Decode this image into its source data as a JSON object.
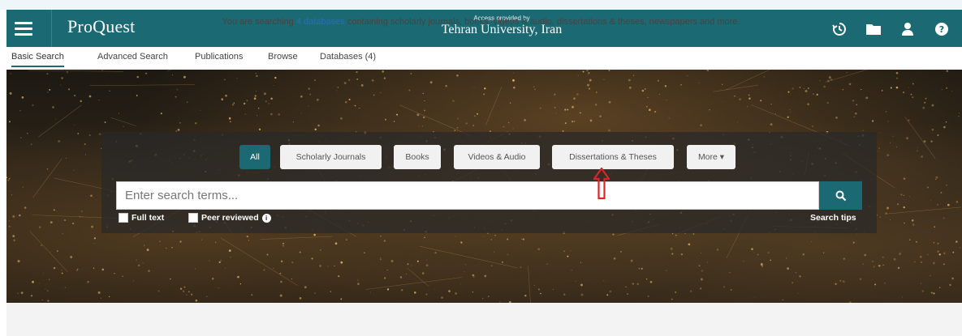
{
  "header": {
    "logo": "ProQuest",
    "access_label": "Access provided by",
    "institution": "Tehran University, Iran",
    "icons": [
      "history-icon",
      "folder-icon",
      "user-icon",
      "help-icon"
    ]
  },
  "nav": {
    "items": [
      {
        "label": "Basic Search",
        "active": true
      },
      {
        "label": "Advanced Search"
      },
      {
        "label": "Publications"
      },
      {
        "label": "Browse"
      },
      {
        "label": "Databases (4)"
      }
    ]
  },
  "search": {
    "tabs": [
      {
        "label": "All"
      },
      {
        "label": "Scholarly Journals"
      },
      {
        "label": "Books"
      },
      {
        "label": "Videos & Audio"
      },
      {
        "label": "Dissertations & Theses"
      },
      {
        "label": "More ▾"
      }
    ],
    "placeholder": "Enter search terms...",
    "full_text_label": "Full text",
    "peer_reviewed_label": "Peer reviewed",
    "info_glyph": "i",
    "search_tips": "Search tips"
  },
  "footer": {
    "prefix": "You are searching ",
    "link": "4 databases",
    "suffix": " containing scholarly journals, books, videos & audio, dissertations & theses, newspapers and more."
  },
  "colors": {
    "brand": "#1b6a73",
    "annotation_arrow": "#d9262b",
    "link": "#2a6db0"
  }
}
